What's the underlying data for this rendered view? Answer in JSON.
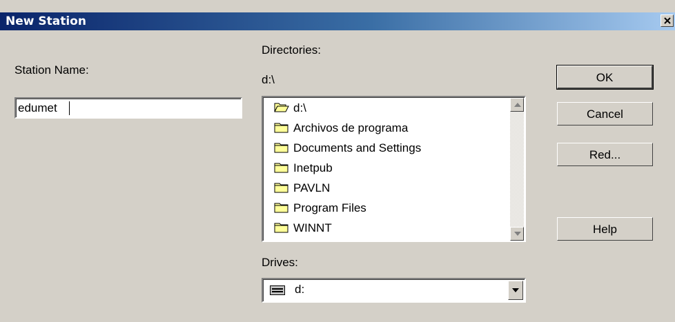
{
  "window": {
    "title": "New Station"
  },
  "station": {
    "label": "Station Name:",
    "value": "edumet"
  },
  "directories": {
    "label": "Directories:",
    "current_path": "d:\\",
    "items": [
      {
        "label": "d:\\",
        "icon": "open-folder-icon"
      },
      {
        "label": "Archivos de programa",
        "icon": "folder-icon"
      },
      {
        "label": "Documents and Settings",
        "icon": "folder-icon"
      },
      {
        "label": "Inetpub",
        "icon": "folder-icon"
      },
      {
        "label": "PAVLN",
        "icon": "folder-icon"
      },
      {
        "label": "Program Files",
        "icon": "folder-icon"
      },
      {
        "label": "WINNT",
        "icon": "folder-icon"
      }
    ]
  },
  "drives": {
    "label": "Drives:",
    "selected": "d:",
    "icon": "drive-icon"
  },
  "buttons": {
    "ok": "OK",
    "cancel": "Cancel",
    "red": "Red...",
    "help": "Help"
  },
  "colors": {
    "title_start": "#0a246a",
    "title_end": "#a6caf0",
    "face": "#d4d0c8",
    "folder": "#ffff99"
  }
}
